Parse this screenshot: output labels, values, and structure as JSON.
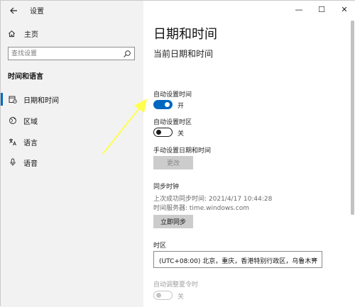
{
  "window": {
    "title": "设置"
  },
  "titlebar": {
    "back_icon": "arrow-left-icon",
    "minimize": "—",
    "maximize": "☐",
    "close": "✕"
  },
  "sidebar": {
    "home": {
      "label": "主页",
      "icon": "home-icon"
    },
    "search": {
      "placeholder": "查找设置",
      "icon": "search-icon"
    },
    "section_title": "时间和语言",
    "items": [
      {
        "label": "日期和时间",
        "icon": "calendar-clock-icon",
        "active": true
      },
      {
        "label": "区域",
        "icon": "globe-icon",
        "active": false
      },
      {
        "label": "语言",
        "icon": "language-icon",
        "active": false
      },
      {
        "label": "语音",
        "icon": "microphone-icon",
        "active": false
      }
    ]
  },
  "main": {
    "title": "日期和时间",
    "subtitle": "当前日期和时间",
    "auto_time": {
      "label": "自动设置时间",
      "state": "开",
      "on": true
    },
    "auto_timezone": {
      "label": "自动设置时区",
      "state": "关",
      "on": false
    },
    "manual": {
      "label": "手动设置日期和时间",
      "button": "更改"
    },
    "sync": {
      "title": "同步时钟",
      "last_sync": "上次成功同步时间: 2021/4/17 10:44:28",
      "server": "时间服务器: time.windows.com",
      "button": "立即同步"
    },
    "timezone": {
      "label": "时区",
      "value": "(UTC+08:00) 北京，重庆，香港特别行政区，乌鲁木齐"
    },
    "dst": {
      "label": "自动调整夏令时",
      "state": "关",
      "on": false,
      "disabled": true
    }
  },
  "colors": {
    "accent": "#0067c0",
    "sidebar_bg": "#f2f2f2",
    "arrow": "#ffff4d"
  }
}
